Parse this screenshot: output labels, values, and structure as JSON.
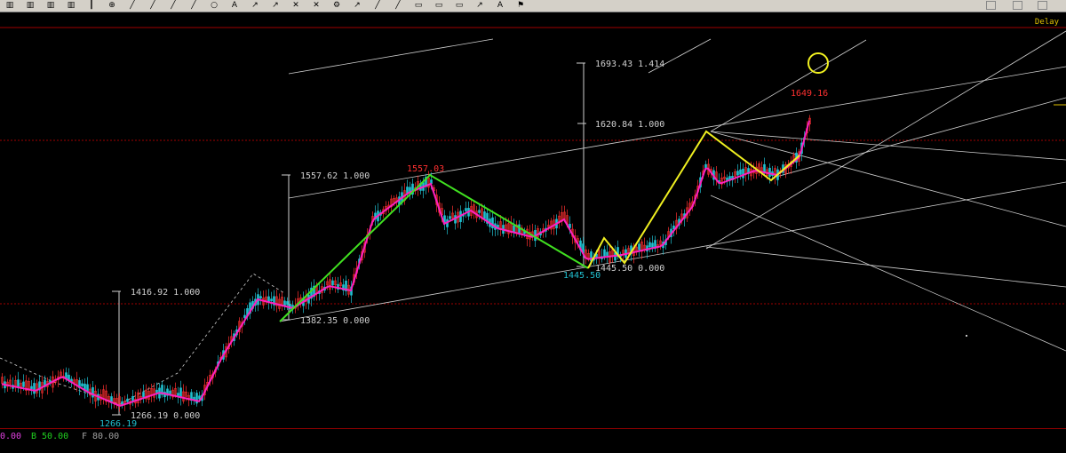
{
  "toolbar": {
    "icons": [
      "bar-chart-icon",
      "bar-chart-icon",
      "bar-chart-icon",
      "bar-chart-icon",
      "candle-icon",
      "zoom-icon",
      "line-icon",
      "line-icon",
      "line-icon",
      "line-icon",
      "circle-icon",
      "text-icon",
      "arrow-icon",
      "arrow-icon",
      "cross-icon",
      "cross-icon",
      "settings-icon",
      "arrow-icon",
      "line-icon",
      "line-icon",
      "box-icon",
      "box-icon",
      "box-icon",
      "arrow-icon",
      "text-icon",
      "flag-icon"
    ]
  },
  "indicator_label": "Delay",
  "levels": {
    "fib_a": {
      "price": "1416.92",
      "ratio": "1.000"
    },
    "fib_a_base": {
      "price": "1266.19",
      "ratio": "0.000"
    },
    "fib_b": {
      "price": "1557.62",
      "ratio": "1.000"
    },
    "fib_b_base": {
      "price": "1382.35",
      "ratio": "0.000"
    },
    "fib_c_top": {
      "price": "1693.43",
      "ratio": "1.414"
    },
    "fib_c": {
      "price": "1620.84",
      "ratio": "1.000"
    },
    "fib_c_base": {
      "price": "1445.50",
      "ratio": "0.000"
    }
  },
  "price_marks": {
    "low_1": "1266.19",
    "high_1": "1557.03",
    "low_2": "1445.50",
    "high_2": "1649.16"
  },
  "legend": [
    {
      "text": "0.00",
      "color": "#e040e0"
    },
    {
      "text": "B 50.00",
      "color": "#20d020"
    },
    {
      "text": "F 80.00",
      "color": "#a0a0a0"
    }
  ],
  "colors": {
    "up_candle": "#ff3030",
    "down_candle": "#20c0d0",
    "ma_line": "#ff20c0",
    "wave_green": "#40e020",
    "wave_yellow": "#f0f020",
    "grid_red": "#a00000"
  }
}
